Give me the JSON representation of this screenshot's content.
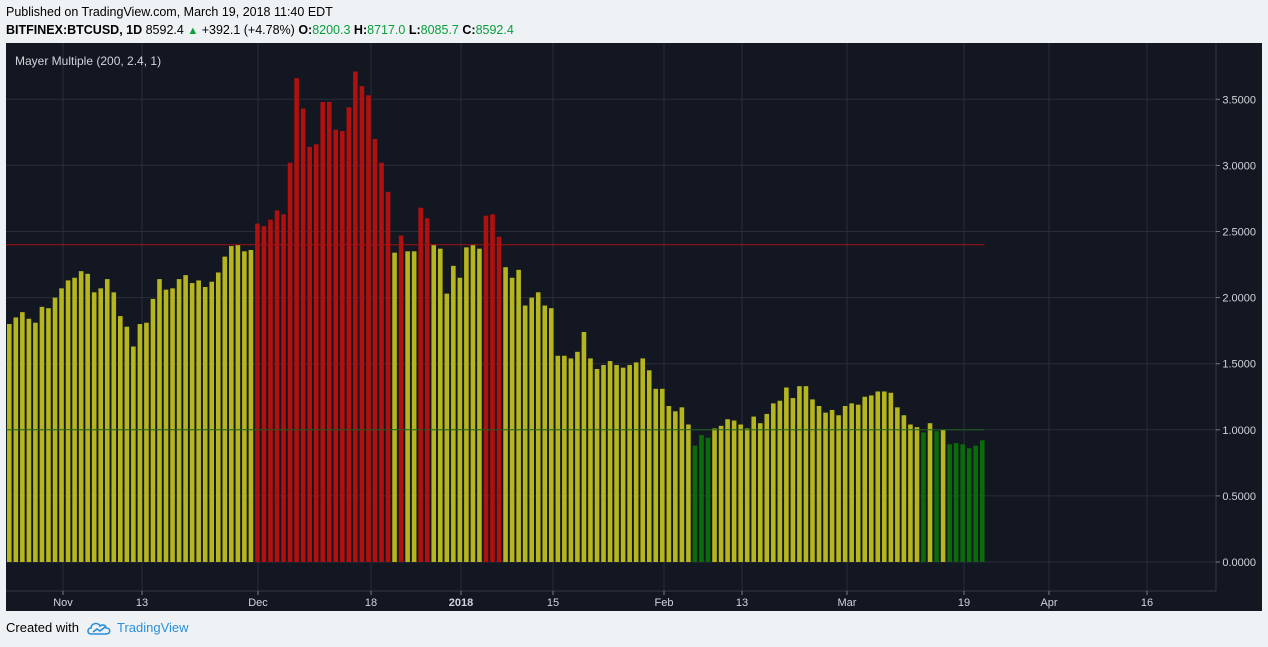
{
  "header": {
    "published": "Published on TradingView.com, March 19, 2018 11:40 EDT",
    "symbol": "BITFINEX:BTCUSD, 1D",
    "last": "8592.4",
    "change": "+392.1 (+4.78%)",
    "o_label": "O:",
    "o_val": "8200.3",
    "h_label": "H:",
    "h_val": "8717.0",
    "l_label": "L:",
    "l_val": "8085.7",
    "c_label": "C:",
    "c_val": "8592.4"
  },
  "footer": {
    "created_with": "Created with",
    "brand": "TradingView"
  },
  "colors": {
    "background": "#131722",
    "grid": "#2a2e39",
    "yellow": "#b5b51e",
    "red": "#b0100e",
    "green": "#0b6b0b",
    "threshold_line": "#a11212",
    "axis_text": "#d1d4dc",
    "up_arrow": "#089e3c"
  },
  "chart_data": {
    "type": "bar",
    "title": "Mayer Multiple (200, 2.4, 1)",
    "x_ticks": [
      "Nov",
      "13",
      "Dec",
      "18",
      "2018",
      "15",
      "Feb",
      "13",
      "Mar",
      "19",
      "Apr",
      "16"
    ],
    "y_ticks": [
      "0.0000",
      "0.5000",
      "1.0000",
      "1.5000",
      "2.0000",
      "2.5000",
      "3.0000",
      "3.5000"
    ],
    "ylim": [
      -0.2,
      3.7
    ],
    "threshold_high": 2.4,
    "threshold_low": 1.0,
    "values": [
      1.8,
      1.85,
      1.89,
      1.84,
      1.81,
      1.93,
      1.92,
      2.0,
      2.07,
      2.13,
      2.15,
      2.2,
      2.18,
      2.04,
      2.07,
      2.14,
      2.04,
      1.86,
      1.78,
      1.63,
      1.8,
      1.81,
      1.99,
      2.14,
      2.06,
      2.07,
      2.14,
      2.17,
      2.11,
      2.13,
      2.08,
      2.12,
      2.19,
      2.31,
      2.39,
      2.4,
      2.35,
      2.36,
      2.56,
      2.54,
      2.59,
      2.66,
      2.63,
      3.02,
      3.66,
      3.43,
      3.14,
      3.16,
      3.48,
      3.48,
      3.27,
      3.26,
      3.44,
      3.71,
      3.6,
      3.53,
      3.2,
      3.02,
      2.8,
      2.34,
      2.47,
      2.35,
      2.35,
      2.68,
      2.6,
      2.4,
      2.37,
      2.03,
      2.24,
      2.15,
      2.38,
      2.4,
      2.37,
      2.62,
      2.63,
      2.46,
      2.23,
      2.15,
      2.21,
      1.94,
      2.0,
      2.04,
      1.94,
      1.92,
      1.56,
      1.56,
      1.54,
      1.59,
      1.74,
      1.54,
      1.46,
      1.49,
      1.52,
      1.49,
      1.47,
      1.49,
      1.51,
      1.54,
      1.45,
      1.31,
      1.31,
      1.18,
      1.14,
      1.17,
      1.04,
      0.88,
      0.96,
      0.94,
      1.01,
      1.03,
      1.08,
      1.07,
      1.04,
      1.01,
      1.1,
      1.05,
      1.12,
      1.2,
      1.22,
      1.32,
      1.24,
      1.33,
      1.33,
      1.23,
      1.18,
      1.13,
      1.15,
      1.11,
      1.18,
      1.2,
      1.19,
      1.25,
      1.26,
      1.29,
      1.29,
      1.28,
      1.17,
      1.11,
      1.04,
      1.02,
      0.98,
      1.05,
      0.99,
      1.0,
      0.89,
      0.9,
      0.89,
      0.86,
      0.88,
      0.92
    ],
    "categories_note": "daily bars from late Oct 2017 to Mar 19 2018; color: red when > 2.4, green when < 1.0, yellow otherwise"
  }
}
